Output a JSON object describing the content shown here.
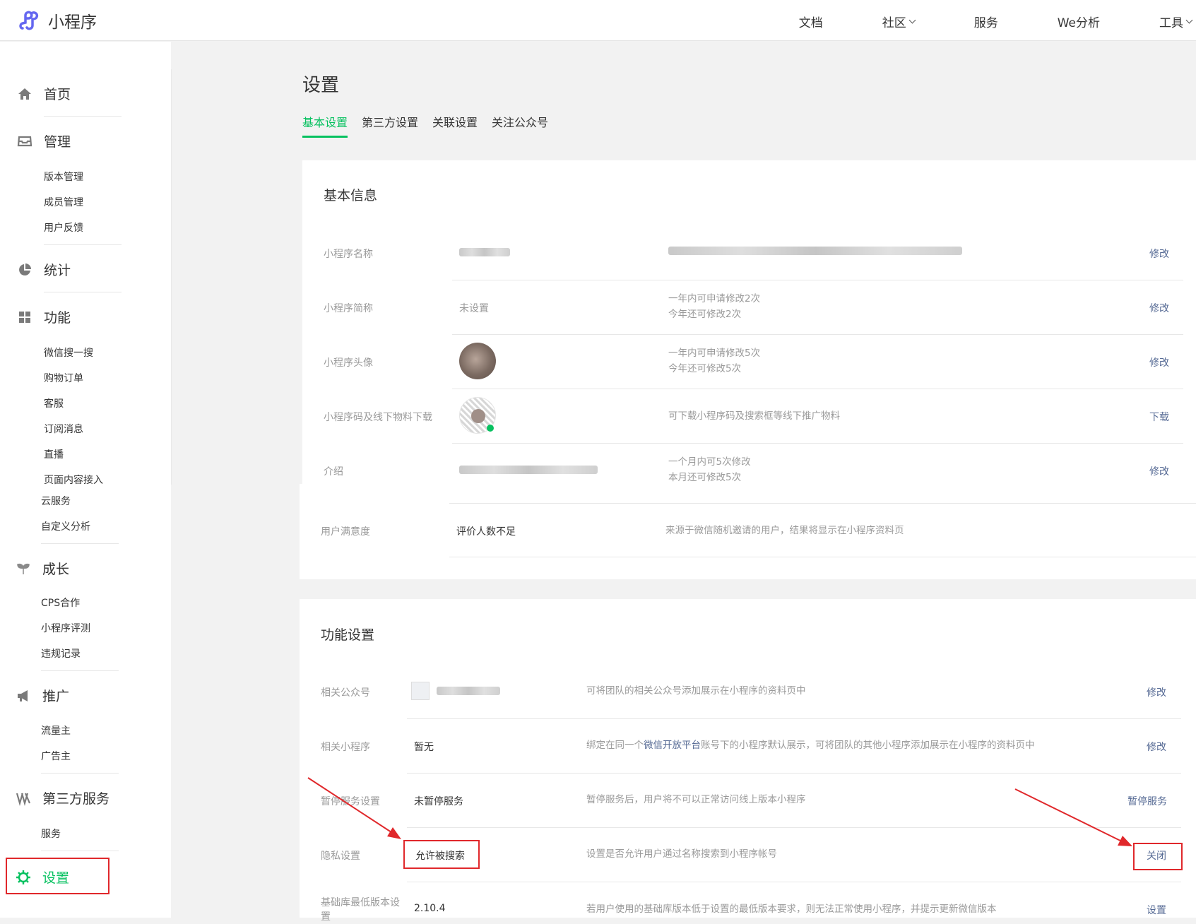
{
  "app": {
    "title": "小程序"
  },
  "topnav": {
    "items": [
      {
        "label": "文档",
        "dropdown": false
      },
      {
        "label": "社区",
        "dropdown": true
      },
      {
        "label": "服务",
        "dropdown": false
      },
      {
        "label": "We分析",
        "dropdown": false
      },
      {
        "label": "工具",
        "dropdown": true
      }
    ]
  },
  "sidebar": {
    "home": "首页",
    "manage": {
      "label": "管理",
      "items": [
        "版本管理",
        "成员管理",
        "用户反馈"
      ]
    },
    "stats": "统计",
    "features": {
      "label": "功能",
      "items": [
        "微信搜一搜",
        "购物订单",
        "客服",
        "订阅消息",
        "直播",
        "页面内容接入",
        "云服务",
        "自定义分析"
      ]
    },
    "growth": {
      "label": "成长",
      "items": [
        "CPS合作",
        "小程序评测",
        "违规记录"
      ]
    },
    "promote": {
      "label": "推广",
      "items": [
        "流量主",
        "广告主"
      ]
    },
    "third": {
      "label": "第三方服务",
      "items": [
        "服务"
      ]
    },
    "settings": "设置"
  },
  "page": {
    "title": "设置",
    "tabs": [
      "基本设置",
      "第三方设置",
      "关联设置",
      "关注公众号"
    ]
  },
  "basic": {
    "title": "基本信息",
    "rows": [
      {
        "label": "小程序名称",
        "value": "",
        "desc1": "",
        "desc2": "",
        "action": "修改"
      },
      {
        "label": "小程序简称",
        "value": "未设置",
        "desc1": "一年内可申请修改2次",
        "desc2": "今年还可修改2次",
        "action": "修改"
      },
      {
        "label": "小程序头像",
        "value": "",
        "desc1": "一年内可申请修改5次",
        "desc2": "今年还可修改5次",
        "action": "修改"
      },
      {
        "label": "小程序码及线下物料下载",
        "value": "",
        "desc1": "可下载小程序码及搜索框等线下推广物料",
        "desc2": "",
        "action": "下载"
      },
      {
        "label": "介绍",
        "value": "",
        "desc1": "一个月内可5次修改",
        "desc2": "本月还可修改5次",
        "action": "修改"
      },
      {
        "label": "用户满意度",
        "value": "评价人数不足",
        "desc1": "来源于微信随机邀请的用户，结果将显示在小程序资料页",
        "desc2": "",
        "action": ""
      }
    ]
  },
  "func": {
    "title": "功能设置",
    "rows": [
      {
        "label": "相关公众号",
        "value": "",
        "desc": "可将团队的相关公众号添加展示在小程序的资料页中",
        "action": "修改"
      },
      {
        "label": "相关小程序",
        "value": "暂无",
        "desc_pre": "绑定在同一个",
        "desc_link": "微信开放平台",
        "desc_post": "账号下的小程序默认展示，可将团队的其他小程序添加展示在小程序的资料页中",
        "action": "修改"
      },
      {
        "label": "暂停服务设置",
        "value": "未暂停服务",
        "desc": "暂停服务后，用户将不可以正常访问线上版本小程序",
        "action": "暂停服务"
      },
      {
        "label": "隐私设置",
        "value": "允许被搜索",
        "desc": "设置是否允许用户通过名称搜索到小程序帐号",
        "action": "关闭"
      },
      {
        "label": "基础库最低版本设置",
        "value": "2.10.4",
        "desc": "若用户使用的基础库版本低于设置的最低版本要求，则无法正常使用小程序，并提示更新微信版本",
        "action": "设置"
      }
    ]
  },
  "colors": {
    "accent": "#07c160",
    "link": "#576b95",
    "annotation": "#e0282b"
  }
}
